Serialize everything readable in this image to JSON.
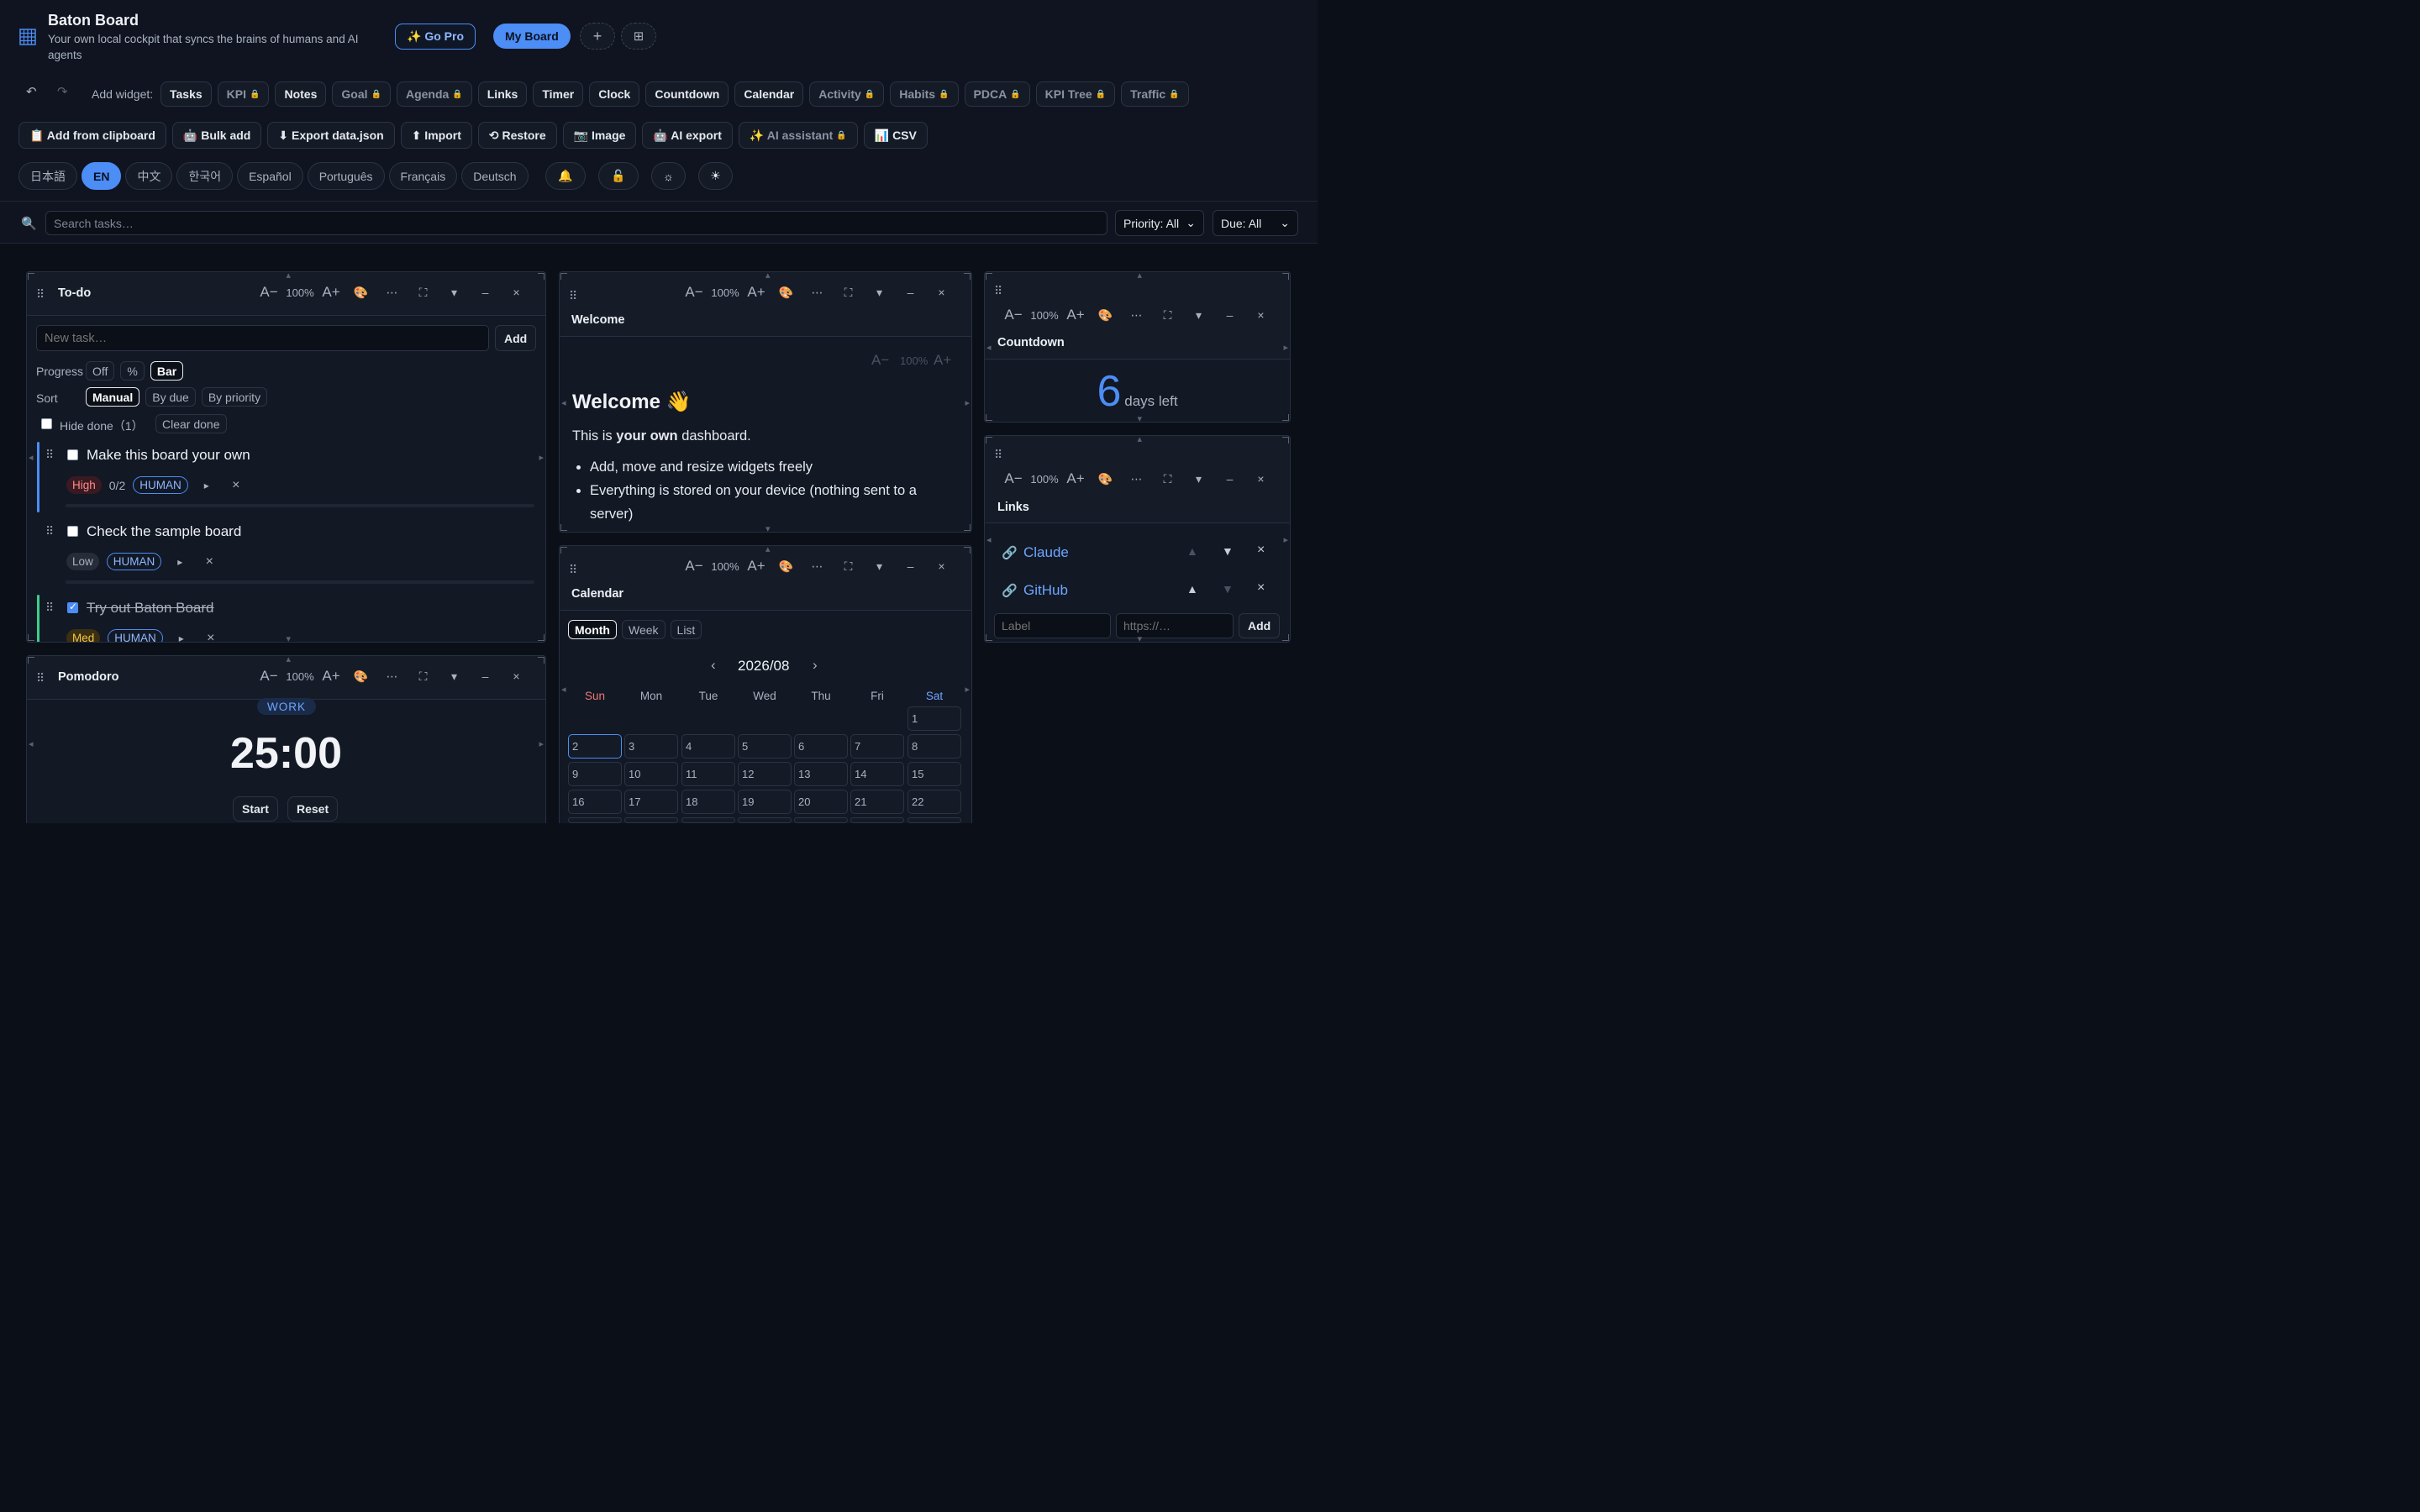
{
  "app": {
    "title": "Baton Board",
    "subtitle": "Your own local cockpit that syncs the brains of humans and AI agents",
    "go_pro": "✨ Go Pro",
    "board_tab": "My Board",
    "add_board": "+",
    "grid_board": "⊞"
  },
  "toolbar": {
    "undo": "↶",
    "redo": "↷",
    "add_widget_label": "Add widget:",
    "widgets": [
      {
        "label": "Tasks",
        "locked": false
      },
      {
        "label": "KPI",
        "locked": true
      },
      {
        "label": "Notes",
        "locked": false
      },
      {
        "label": "Goal",
        "locked": true
      },
      {
        "label": "Agenda",
        "locked": true
      },
      {
        "label": "Links",
        "locked": false
      },
      {
        "label": "Timer",
        "locked": false
      },
      {
        "label": "Clock",
        "locked": false
      },
      {
        "label": "Countdown",
        "locked": false
      },
      {
        "label": "Calendar",
        "locked": false
      },
      {
        "label": "Activity",
        "locked": true
      },
      {
        "label": "Habits",
        "locked": true
      },
      {
        "label": "PDCA",
        "locked": true
      },
      {
        "label": "KPI Tree",
        "locked": true
      },
      {
        "label": "Traffic",
        "locked": true
      }
    ],
    "actions": [
      {
        "label": "📋 Add from clipboard",
        "locked": false
      },
      {
        "label": "🤖 Bulk add",
        "locked": false
      },
      {
        "label": "⬇ Export data.json",
        "locked": false
      },
      {
        "label": "⬆ Import",
        "locked": false
      },
      {
        "label": "⟲ Restore",
        "locked": false
      },
      {
        "label": "📷 Image",
        "locked": false
      },
      {
        "label": "🤖 AI export",
        "locked": false
      },
      {
        "label": "✨ AI assistant",
        "locked": true
      },
      {
        "label": "📊 CSV",
        "locked": false
      }
    ],
    "languages": [
      "日本語",
      "EN",
      "中文",
      "한국어",
      "Español",
      "Português",
      "Français",
      "Deutsch"
    ],
    "active_language": "EN",
    "icons": [
      "🔔",
      "🔓",
      "☼",
      "☀"
    ],
    "lock_glyph": "🔒"
  },
  "search": {
    "icon": "🔍",
    "placeholder": "Search tasks…",
    "priority": "Priority: All",
    "due": "Due: All",
    "caret": "⌄"
  },
  "widget_tools": {
    "a_minus": "A−",
    "zoom": "100%",
    "a_plus": "A+",
    "palette": "🎨",
    "more": "⋯",
    "expand": "⛶",
    "collapse": "▾",
    "minimize": "–",
    "close": "×",
    "grip": "⠿"
  },
  "todo": {
    "title": "To-do",
    "new_task_placeholder": "New task…",
    "add_label": "Add",
    "progress_label": "Progress",
    "progress_options": [
      "Off",
      "%",
      "Bar"
    ],
    "progress_active": "Bar",
    "sort_label": "Sort",
    "sort_options": [
      "Manual",
      "By due",
      "By priority"
    ],
    "sort_active": "Manual",
    "hide_done_label": "Hide done（1）",
    "clear_done": "Clear done",
    "tasks": [
      {
        "title": "Make this board your own",
        "priority": "High",
        "progress": "0/2",
        "owner": "HUMAN",
        "done": false
      },
      {
        "title": "Check the sample board",
        "priority": "Low",
        "progress": "",
        "owner": "HUMAN",
        "done": false
      },
      {
        "title": "Try out Baton Board",
        "priority": "Med",
        "progress": "",
        "owner": "HUMAN",
        "done": true
      }
    ],
    "play_glyph": "▸",
    "delete_glyph": "×"
  },
  "welcome": {
    "title": "Welcome",
    "heading": "Welcome 👋",
    "intro_prefix": "This is ",
    "intro_bold": "your own",
    "intro_suffix": " dashboard.",
    "bullets": [
      "Add, move and resize widgets freely",
      "Everything is stored on your device (nothing sent to a server)"
    ]
  },
  "countdown": {
    "title": "Countdown",
    "number": "6",
    "unit": "days left"
  },
  "links": {
    "title": "Links",
    "items": [
      {
        "label": "Claude"
      },
      {
        "label": "GitHub"
      }
    ],
    "link_glyph": "🔗",
    "up": "▲",
    "down": "▼",
    "label_placeholder": "Label",
    "url_placeholder": "https://…",
    "add_label": "Add"
  },
  "pomodoro": {
    "title": "Pomodoro",
    "mode": "WORK",
    "time": "25:00",
    "start": "Start",
    "reset": "Reset"
  },
  "calendar": {
    "title": "Calendar",
    "views": [
      "Month",
      "Week",
      "List"
    ],
    "active_view": "Month",
    "month": "2026/08",
    "prev": "‹",
    "next": "›",
    "weekdays": [
      "Sun",
      "Mon",
      "Tue",
      "Wed",
      "Thu",
      "Fri",
      "Sat"
    ],
    "days": [
      "1",
      "2",
      "3",
      "4",
      "5",
      "6",
      "7",
      "8",
      "9",
      "10",
      "11",
      "12",
      "13",
      "14",
      "15",
      "16",
      "17",
      "18",
      "19",
      "20",
      "21",
      "22"
    ],
    "today": "2",
    "colors": {
      "sun": "#f07878",
      "sat": "#6ea5ff"
    }
  },
  "colors": {
    "accent": "#4c8df6",
    "high_stripe": "#4c8df6",
    "done_stripe": "#3ccf8e"
  }
}
